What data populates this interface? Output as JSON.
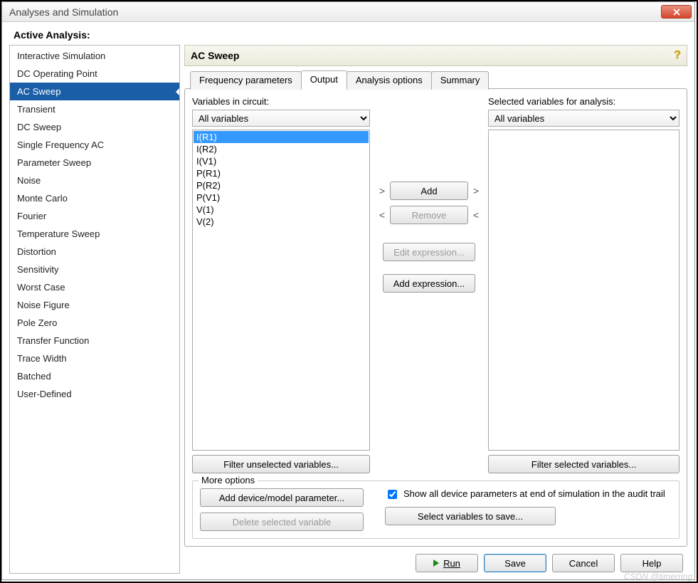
{
  "window": {
    "title": "Analyses and Simulation"
  },
  "activeAnalysisLabel": "Active Analysis:",
  "sidebar": {
    "selected": "AC Sweep",
    "items": [
      "Interactive Simulation",
      "DC Operating Point",
      "AC Sweep",
      "Transient",
      "DC Sweep",
      "Single Frequency AC",
      "Parameter Sweep",
      "Noise",
      "Monte Carlo",
      "Fourier",
      "Temperature Sweep",
      "Distortion",
      "Sensitivity",
      "Worst Case",
      "Noise Figure",
      "Pole Zero",
      "Transfer Function",
      "Trace Width",
      "Batched",
      "User-Defined"
    ]
  },
  "panel": {
    "title": "AC Sweep"
  },
  "tabs": {
    "active": "Output",
    "items": [
      "Frequency parameters",
      "Output",
      "Analysis options",
      "Summary"
    ]
  },
  "output": {
    "leftLabel": "Variables in circuit:",
    "rightLabel": "Selected variables for analysis:",
    "leftFilter": "All variables",
    "rightFilter": "All variables",
    "leftList": [
      "I(R1)",
      "I(R2)",
      "I(V1)",
      "P(R1)",
      "P(R2)",
      "P(V1)",
      "V(1)",
      "V(2)"
    ],
    "leftSelected": "I(R1)",
    "rightList": [],
    "addLabel": "Add",
    "removeLabel": "Remove",
    "editExprLabel": "Edit expression...",
    "addExprLabel": "Add expression...",
    "filterUnselLabel": "Filter unselected variables...",
    "filterSelLabel": "Filter selected variables..."
  },
  "moreOptions": {
    "legend": "More options",
    "addParamLabel": "Add device/model parameter...",
    "deleteVarLabel": "Delete selected variable",
    "showAllChecked": true,
    "showAllLabel": "Show all device parameters at end of simulation in the audit trail",
    "selectVarsLabel": "Select variables to save..."
  },
  "footer": {
    "run": "Run",
    "save": "Save",
    "cancel": "Cancel",
    "help": "Help"
  },
  "watermark": "CSDN @timerring"
}
